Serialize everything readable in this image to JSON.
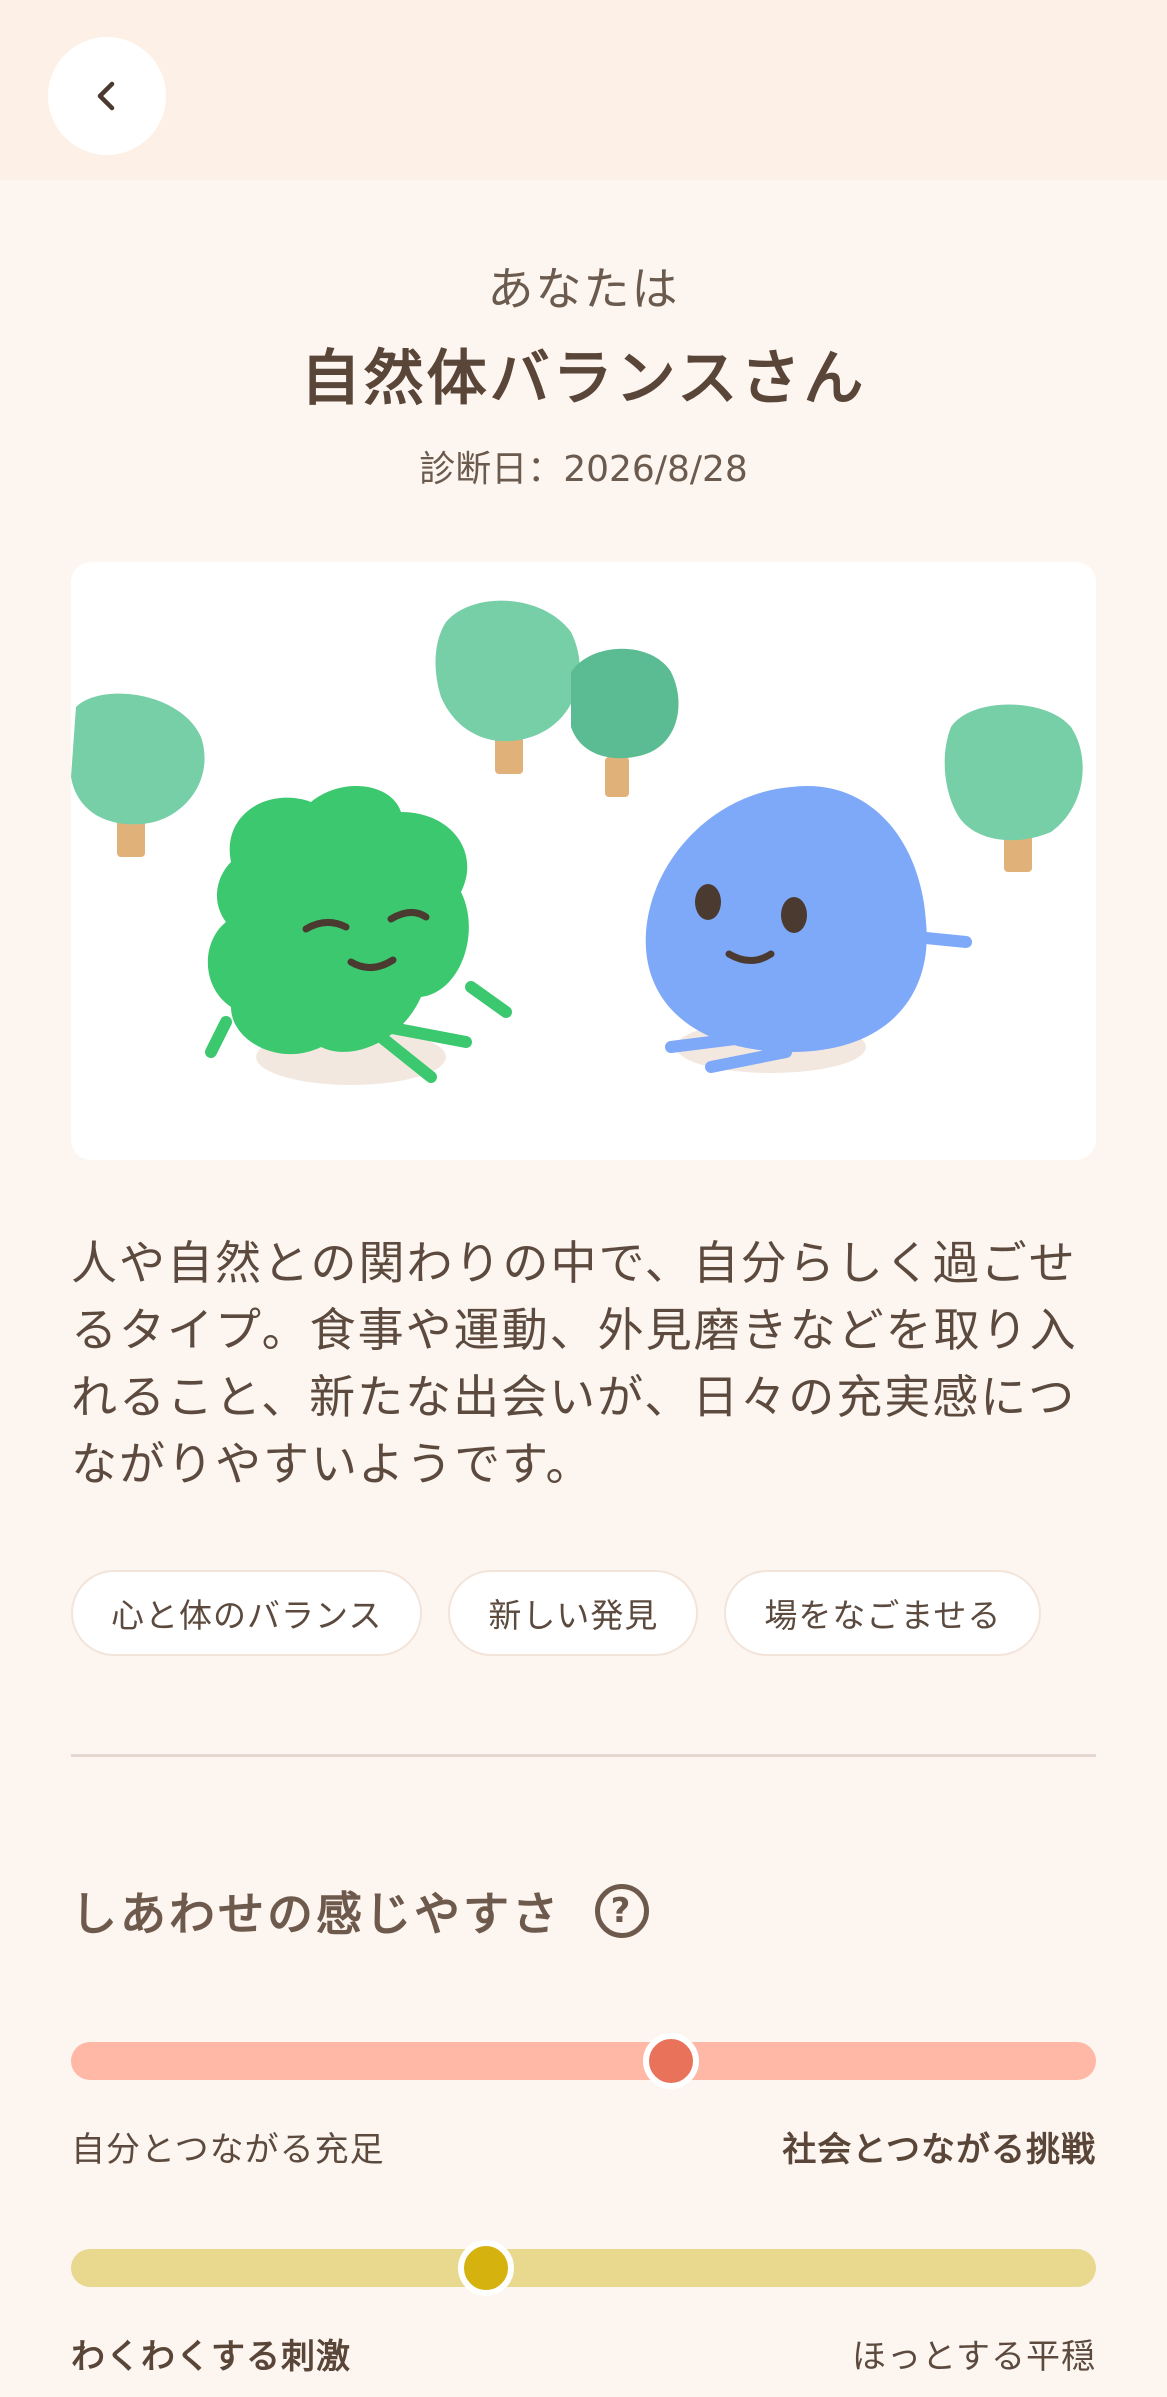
{
  "header": {
    "back_icon": "chevron-left-icon"
  },
  "result": {
    "subtitle": "あなたは",
    "title": "自然体バランスさん",
    "date": "診断日：2026/8/28"
  },
  "illustration": {
    "icon": "two-characters-in-forest-illustration",
    "colors": {
      "green_character": "#3cc86f",
      "blue_character": "#7ea9f9",
      "tree": "#76cfa7"
    }
  },
  "description": "人や自然との関わりの中で、自分らしく過ごせるタイプ。食事や運動、外見磨きなどを取り入れること、新たな出会いが、日々の充実感につながりやすいようです。",
  "tags": [
    "心と体のバランス",
    "新しい発見",
    "場をなごませる"
  ],
  "happiness": {
    "title": "しあわせの感じやすさ",
    "help_icon": "question-circle-icon",
    "help_glyph": "?",
    "sliders": [
      {
        "left_label": "自分とつながる充足",
        "right_label": "社会とつながる挑戦",
        "value": 0.585,
        "emphasis": "right",
        "track_color": "#ffb8a6",
        "knob_color": "#e8725a"
      },
      {
        "left_label": "わくわくする刺激",
        "right_label": "ほっとする平穏",
        "value": 0.405,
        "emphasis": "left",
        "track_color": "#e8d98f",
        "knob_color": "#d5b20e"
      }
    ]
  }
}
